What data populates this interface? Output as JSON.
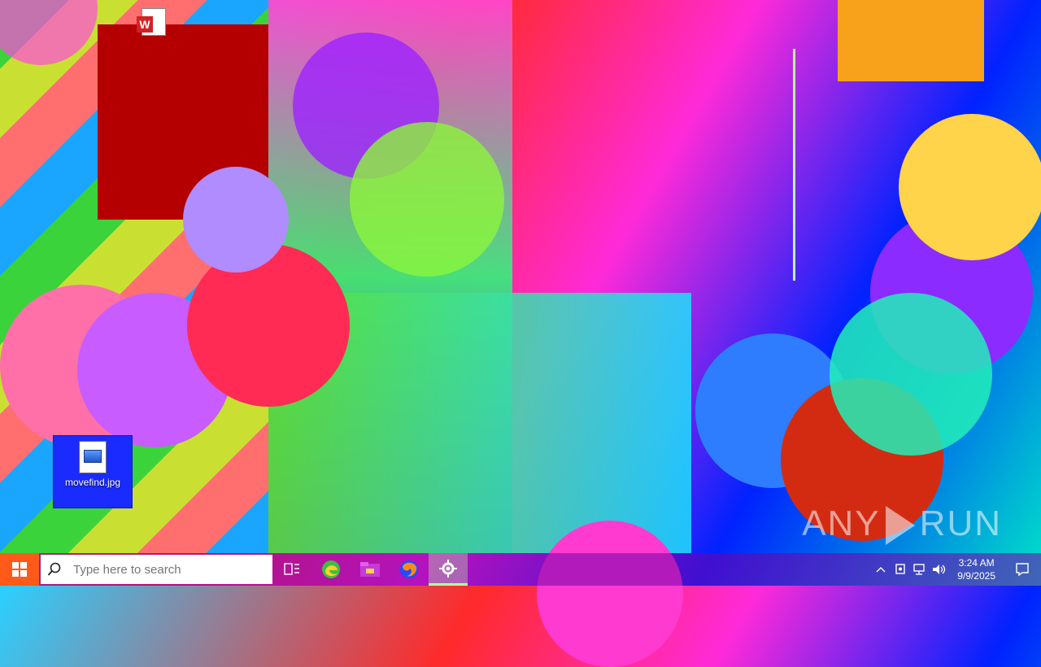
{
  "desktop": {
    "icons": [
      {
        "label": "movefind.jpg",
        "selected": true,
        "icon": "image-file-icon"
      }
    ],
    "word_icon": {
      "glyph": "W",
      "icon": "word-document-icon"
    }
  },
  "taskbar": {
    "start_icon": "windows-logo-icon",
    "search": {
      "placeholder": "Type here to search"
    },
    "apps": [
      {
        "name": "task-view",
        "icon": "task-view-icon"
      },
      {
        "name": "edge",
        "icon": "edge-icon"
      },
      {
        "name": "file-explorer",
        "icon": "folder-icon"
      },
      {
        "name": "firefox",
        "icon": "firefox-icon"
      },
      {
        "name": "settings",
        "icon": "gear-icon",
        "active": true
      }
    ],
    "tray": {
      "clock_time": "3:24 AM",
      "clock_date": "9/9/2025"
    }
  },
  "watermark": {
    "text_left": "ANY",
    "text_right": "RUN"
  },
  "colors": {
    "start": "#ff5a1a",
    "selected_icon": "#1a2bff",
    "taskbar": "#7400aa"
  }
}
